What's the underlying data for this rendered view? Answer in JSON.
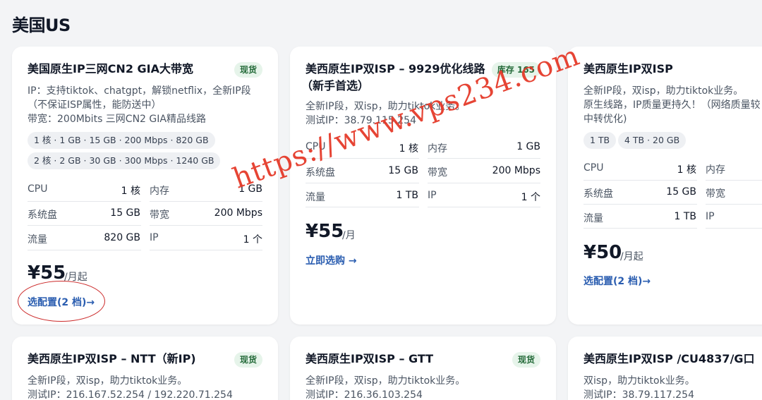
{
  "section": {
    "title": "美国US"
  },
  "cards": [
    {
      "title": "美国原生IP三网CN2 GIA大带宽",
      "badge": "现货",
      "desc": [
        "IP：支持tiktok、chatgpt，解锁netflix，全新IP段",
        "（不保证ISP属性，能防送中）",
        "带宽：200Mbits 三网CN2 GIA精品线路"
      ],
      "chips": [
        "1 核 · 1 GB · 15 GB · 200 Mbps · 820 GB",
        "2 核 · 2 GB · 30 GB · 300 Mbps · 1240 GB"
      ],
      "specs": [
        {
          "label": "CPU",
          "value": "1 核"
        },
        {
          "label": "内存",
          "value": "1 GB"
        },
        {
          "label": "系统盘",
          "value": "15 GB"
        },
        {
          "label": "带宽",
          "value": "200 Mbps"
        },
        {
          "label": "流量",
          "value": "820 GB"
        },
        {
          "label": "IP",
          "value": "1 个"
        }
      ],
      "price": "¥55",
      "price_unit": "/月起",
      "link": "选配置(2 档)→"
    },
    {
      "title": "美西原生IP双ISP – 9929优化线路",
      "title2": "（新手首选）",
      "badge": "库存 165",
      "desc": [
        "全新IP段，双isp，助力tiktok业务。",
        "测试IP：38.79.115.254"
      ],
      "specs": [
        {
          "label": "CPU",
          "value": "1 核"
        },
        {
          "label": "内存",
          "value": "1 GB"
        },
        {
          "label": "系统盘",
          "value": "15 GB"
        },
        {
          "label": "带宽",
          "value": "200 Mbps"
        },
        {
          "label": "流量",
          "value": "1 TB"
        },
        {
          "label": "IP",
          "value": "1 个"
        }
      ],
      "price": "¥55",
      "price_unit": "/月",
      "link": "立即选购 →"
    },
    {
      "title": "美西原生IP双ISP",
      "desc": [
        "全新IP段，双isp，助力tiktok业务。",
        "原生线路，IP质量更持久！（网络质量较",
        "中转优化)"
      ],
      "chips": [
        "1 TB",
        "4 TB · 20 GB"
      ],
      "specs": [
        {
          "label": "CPU",
          "value": "1 核"
        },
        {
          "label": "内存",
          "value": ""
        },
        {
          "label": "系统盘",
          "value": "15 GB"
        },
        {
          "label": "带宽",
          "value": ""
        },
        {
          "label": "流量",
          "value": "1 TB"
        },
        {
          "label": "IP",
          "value": ""
        }
      ],
      "price": "¥50",
      "price_unit": "/月起",
      "link": "选配置(2 档)→"
    },
    {
      "title": "美西原生IP双ISP – NTT（新IP)",
      "badge": "现货",
      "desc": [
        "全新IP段，双isp，助力tiktok业务。",
        "测试IP：216.167.52.254 / 192.220.71.254"
      ]
    },
    {
      "title": "美西原生IP双ISP – GTT",
      "badge": "现货",
      "desc": [
        "全新IP段，双isp，助力tiktok业务。",
        "测试IP：216.36.103.254"
      ]
    },
    {
      "title": "美西原生IP双ISP /CU4837/G口",
      "desc": [
        "双isp，助力tiktok业务。",
        "测试IP：38.79.117.254"
      ]
    }
  ],
  "watermark": "https://www.vps234.com"
}
